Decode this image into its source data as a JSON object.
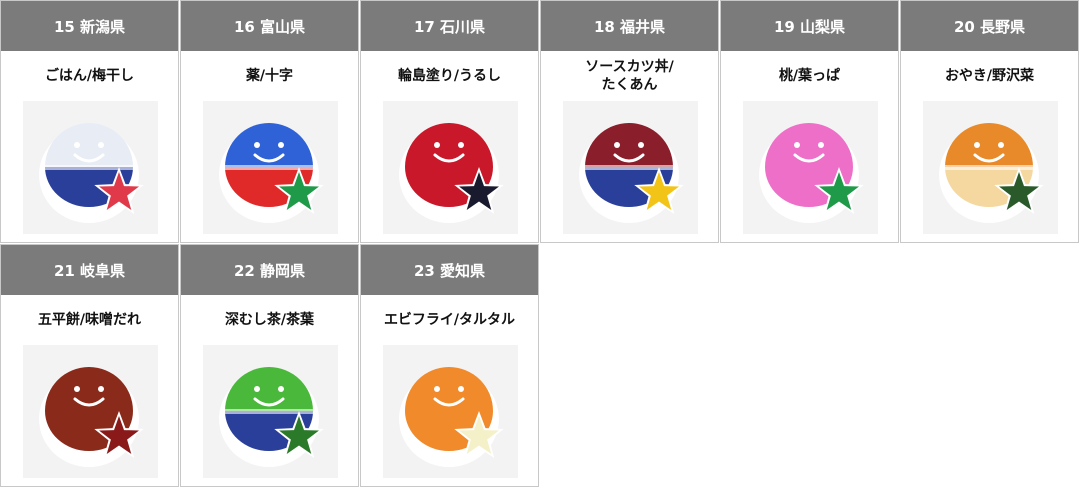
{
  "cards": [
    {
      "region": "15 新潟県",
      "food": "ごはん/梅干し",
      "body_color": "#e8ecf4",
      "bottom_color": "#2a3f9a",
      "star_color": "#e03a4a",
      "icon": "rice-bowl-sticker-icon"
    },
    {
      "region": "16 富山県",
      "food": "薬/十字",
      "body_color": "#2e62d6",
      "bottom_color": "#e02a2a",
      "star_color": "#1e9a48",
      "icon": "medicine-capsule-sticker-icon"
    },
    {
      "region": "17 石川県",
      "food": "輪島塗り/うるし",
      "body_color": "#c8182a",
      "bottom_color": "#c8182a",
      "star_color": "#1a1a2e",
      "icon": "lacquerware-sticker-icon"
    },
    {
      "region": "18 福井県",
      "food": "ソースカツ丼/\nたくあん",
      "body_color": "#8a1e2a",
      "bottom_color": "#2a3f9a",
      "star_color": "#f2c418",
      "icon": "sauce-katsudon-sticker-icon"
    },
    {
      "region": "19 山梨県",
      "food": "桃/葉っぱ",
      "body_color": "#ee6fc8",
      "bottom_color": "#ee6fc8",
      "star_color": "#1e9a48",
      "icon": "peach-sticker-icon"
    },
    {
      "region": "20 長野県",
      "food": "おやき/野沢菜",
      "body_color": "#e88a2a",
      "bottom_color": "#f4d8a0",
      "star_color": "#2a5a2a",
      "icon": "oyaki-sticker-icon"
    },
    {
      "region": "21 岐阜県",
      "food": "五平餅/味噌だれ",
      "body_color": "#8a2a1a",
      "bottom_color": "#8a2a1a",
      "star_color": "#8a1a1a",
      "icon": "gohei-mochi-sticker-icon"
    },
    {
      "region": "22 静岡県",
      "food": "深むし茶/茶葉",
      "body_color": "#4ab83a",
      "bottom_color": "#2a3f9a",
      "star_color": "#2a7a2a",
      "icon": "green-tea-cup-sticker-icon"
    },
    {
      "region": "23 愛知県",
      "food": "エビフライ/タルタル",
      "body_color": "#f08a2a",
      "bottom_color": "#f08a2a",
      "star_color": "#f4f0c8",
      "icon": "fried-shrimp-sticker-icon"
    }
  ]
}
